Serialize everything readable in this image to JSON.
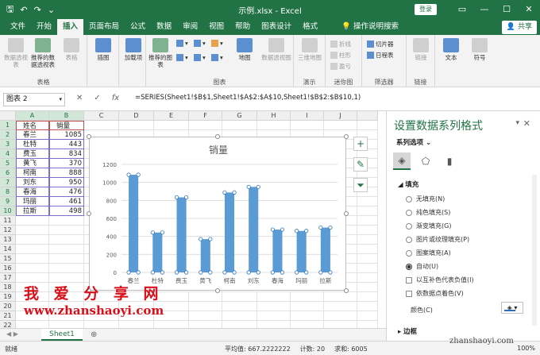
{
  "titlebar": {
    "title": "示例.xlsx  -  Excel",
    "login": "登录"
  },
  "tabs": [
    "文件",
    "开始",
    "插入",
    "页面布局",
    "公式",
    "数据",
    "审阅",
    "视图",
    "帮助",
    "图表设计",
    "格式"
  ],
  "active_tab": "插入",
  "tell_me": "操作说明搜索",
  "share": "共享",
  "ribbon": {
    "groups": [
      {
        "label": "表格",
        "buttons": [
          "数据透视表",
          "推荐的数据透视表",
          "表格"
        ]
      },
      {
        "label": "",
        "buttons": [
          "插图"
        ]
      },
      {
        "label": "",
        "buttons": [
          "加载项"
        ]
      },
      {
        "label": "图表",
        "buttons": [
          "推荐的图表",
          "地图",
          "数据透视图"
        ]
      },
      {
        "label": "演示",
        "buttons": [
          "三维地图"
        ]
      },
      {
        "label": "迷你图",
        "buttons": [
          "折线",
          "柱形",
          "盈亏"
        ]
      },
      {
        "label": "筛选器",
        "buttons": [
          "切片器",
          "日程表"
        ]
      },
      {
        "label": "链接",
        "buttons": [
          "链接"
        ]
      },
      {
        "label": "",
        "buttons": [
          "文本",
          "符号"
        ]
      }
    ]
  },
  "namebox": "图表 2",
  "formula": "=SERIES(Sheet1!$B$1,Sheet1!$A$2:$A$10,Sheet1!$B$2:$B$10,1)",
  "columns": [
    "A",
    "B",
    "C",
    "D",
    "E",
    "F",
    "G",
    "H",
    "I",
    "J"
  ],
  "rows": [
    "1",
    "2",
    "3",
    "4",
    "5",
    "6",
    "7",
    "8",
    "9",
    "10",
    "11",
    "12",
    "13",
    "14",
    "15",
    "16",
    "17",
    "18",
    "19",
    "20",
    "21",
    "22"
  ],
  "table": {
    "header": [
      "姓名",
      "销量"
    ],
    "rows": [
      [
        "春兰",
        "1085"
      ],
      [
        "杜特",
        "443"
      ],
      [
        "费玉",
        "834"
      ],
      [
        "黄飞",
        "370"
      ],
      [
        "柯南",
        "888"
      ],
      [
        "刘东",
        "950"
      ],
      [
        "春海",
        "476"
      ],
      [
        "玛丽",
        "461"
      ],
      [
        "拉斯",
        "498"
      ]
    ]
  },
  "chart_data": {
    "type": "bar",
    "title": "销量",
    "categories": [
      "春兰",
      "杜特",
      "费玉",
      "黄飞",
      "柯南",
      "刘东",
      "春海",
      "玛丽",
      "拉斯"
    ],
    "values": [
      1085,
      443,
      834,
      370,
      888,
      950,
      476,
      461,
      498
    ],
    "ylim": [
      0,
      1200
    ],
    "yticks": [
      "0",
      "200",
      "400",
      "600",
      "800",
      "1000",
      "1200"
    ],
    "grid": true,
    "bar_color": "#5b9bd5"
  },
  "pane": {
    "title": "设置数据系列格式",
    "subtitle": "系列选项",
    "section_fill": "填充",
    "options": [
      "无填充(N)",
      "纯色填充(S)",
      "渐变填充(G)",
      "图片或纹理填充(P)",
      "图案填充(A)",
      "自动(U)"
    ],
    "checks": [
      "以互补色代表负值(I)",
      "依数据点着色(V)"
    ],
    "color_label": "颜色(C)",
    "section_border": "边框"
  },
  "sheet_tab": "Sheet1",
  "status": {
    "ready": "就绪",
    "average": "平均值: 667.2222222",
    "count": "计数: 20",
    "sum": "求和: 6005",
    "zoom": "100%"
  },
  "watermark": {
    "cn": "我 爱 分 享 网",
    "url": "www.zhanshaoyi.com",
    "corner": "zhanshaoyi.com"
  }
}
